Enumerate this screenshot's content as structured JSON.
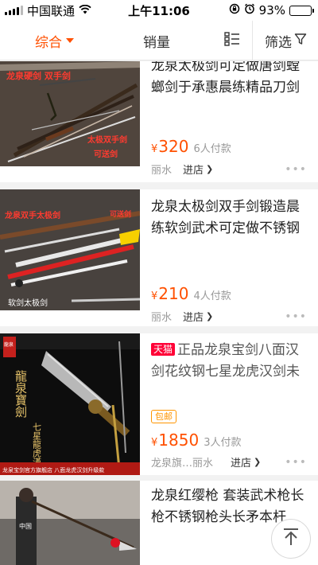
{
  "status_bar": {
    "carrier": "中国联通",
    "time": "上午11:06",
    "battery_text": "93%",
    "battery_level_percent": 93
  },
  "filter_bar": {
    "sort_label": "综合",
    "sales_label": "销量",
    "filter_label": "筛选",
    "accent_color": "#ff5000"
  },
  "products": [
    {
      "title": "龙泉太极剑可定做唐剑螳螂剑于承惠晨练精品刀剑",
      "price": "320",
      "currency": "¥",
      "sold": "6人付款",
      "location": "丽水",
      "shop_link": "进店",
      "image_labels": [
        "龙泉硬剑 双手剑",
        "太极双手剑",
        "可送剑"
      ]
    },
    {
      "title": "龙泉太极剑双手剑锻造晨练软剑武术可定做不锈钢",
      "price": "210",
      "currency": "¥",
      "sold": "4人付款",
      "location": "丽水",
      "shop_link": "进店",
      "image_labels": [
        "龙泉双手太极剑",
        "可送剑",
        "软剑太极剑"
      ]
    },
    {
      "tmall_badge": "天猫",
      "title": "正品龙泉宝剑八面汉剑花纹钢七星龙虎汉剑未",
      "free_shipping": "包邮",
      "price": "1850",
      "currency": "¥",
      "sold": "3人付款",
      "location": "龙泉旗…丽水",
      "shop_link": "进店",
      "image_labels": [
        "龍泉寶劍",
        "七星龍虎漢劍",
        "龙泉宝剑官方旗舰店 八面龙虎汉剑升级款",
        "龍泉"
      ]
    },
    {
      "title": "龙泉红缨枪 套装武术枪长枪不锈钢枪头长矛本杆",
      "image_labels": [
        "中国"
      ]
    }
  ]
}
